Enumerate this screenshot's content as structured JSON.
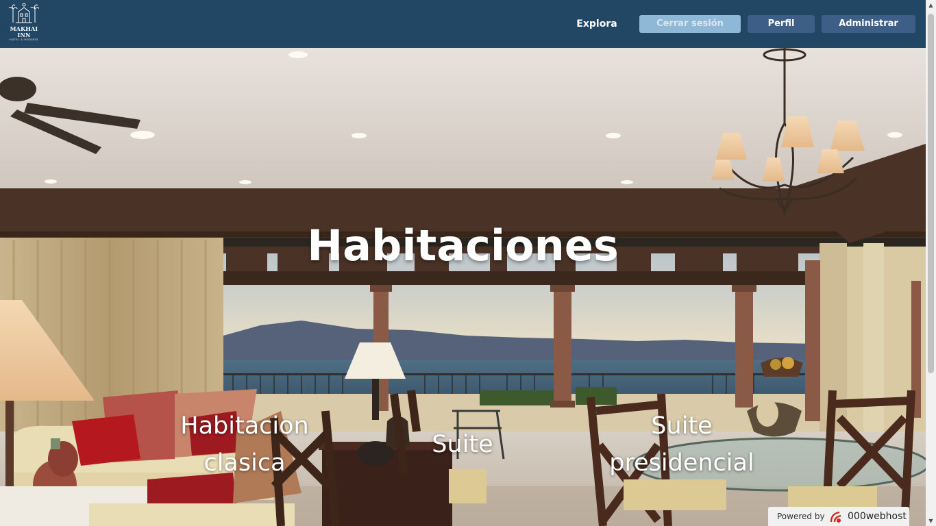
{
  "header": {
    "logo": {
      "name": "MAKHAI INN",
      "subtitle": "HOTEL & RESORTS",
      "icon": "hotel-logo-icon"
    },
    "nav_link": "Explora",
    "buttons": {
      "logout": "Cerrar sesión",
      "profile": "Perfil",
      "admin": "Administrar"
    },
    "colors": {
      "navbar": "#224764",
      "button": "#3d5f87",
      "logout_button": "#8fb8d6"
    }
  },
  "hero": {
    "title": "Habitaciones",
    "background": "hotel-living-room-ocean-view-photo"
  },
  "rooms": [
    {
      "label": "Habitacion clasica"
    },
    {
      "label": "Suite"
    },
    {
      "label": "Suite presidencial"
    }
  ],
  "badge": {
    "prefix": "Powered by",
    "brand": "000webhost",
    "icon": "000webhost-logo-icon"
  }
}
